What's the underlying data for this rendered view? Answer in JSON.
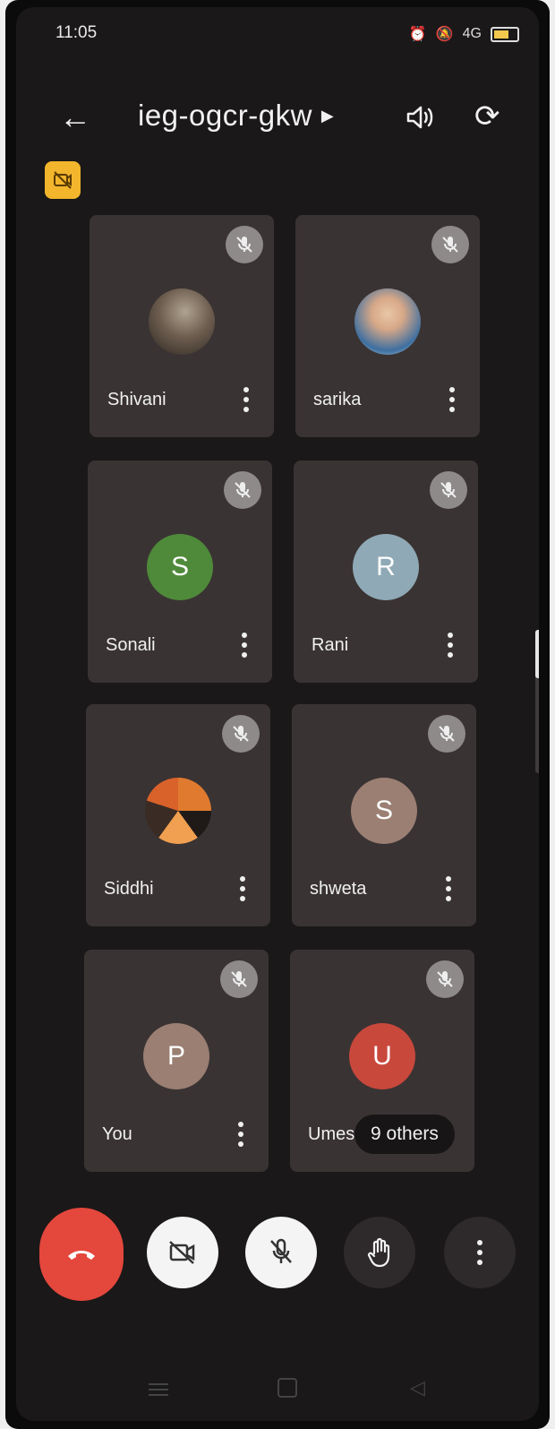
{
  "status_bar": {
    "time": "11:05",
    "signal": "4G",
    "battery_color": "#f2c94c"
  },
  "header": {
    "title": "ieg-ogcr-gkw"
  },
  "participants": [
    {
      "name": "Shivani",
      "avatar": "photo",
      "muted": true
    },
    {
      "name": "sarika",
      "avatar": "photo",
      "muted": true
    },
    {
      "name": "Sonali",
      "initial": "S",
      "avatar_color": "#4f8a3a",
      "muted": true
    },
    {
      "name": "Rani",
      "initial": "R",
      "avatar_color": "#8fa9b6",
      "muted": true
    },
    {
      "name": "Siddhi",
      "avatar": "photo",
      "muted": true
    },
    {
      "name": "shweta",
      "initial": "S",
      "avatar_color": "#9b7f72",
      "muted": true
    },
    {
      "name": "You",
      "initial": "P",
      "avatar_color": "#9a7f72",
      "muted": true
    },
    {
      "name": "Umes",
      "initial": "U",
      "avatar_color": "#c9483c",
      "muted": true
    }
  ],
  "others_label": "9 others",
  "controls": {
    "hangup_color": "#e4473c",
    "items": [
      "end-call",
      "camera-off",
      "mic-off",
      "raise-hand",
      "more-options"
    ]
  }
}
